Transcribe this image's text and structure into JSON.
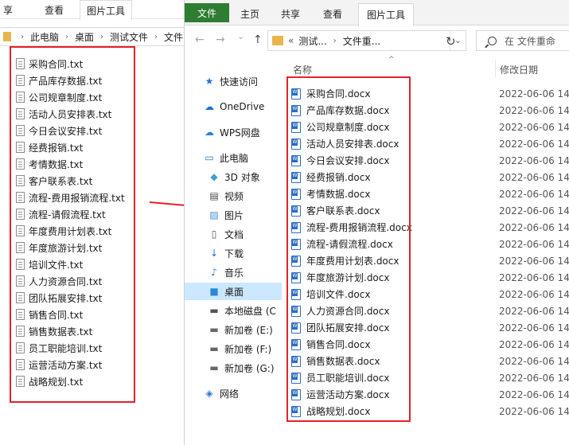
{
  "back_window": {
    "ribbon_tabs": [
      "享",
      "查看",
      "图片工具"
    ],
    "breadcrumb": [
      "此电脑",
      "桌面",
      "测试文件",
      "文件"
    ],
    "files": [
      "采购合同.txt",
      "产品库存数据.txt",
      "公司规章制度.txt",
      "活动人员安排表.txt",
      "今日会议安排.txt",
      "经费报销.txt",
      "考情数据.txt",
      "客户联系表.txt",
      "流程-费用报销流程.txt",
      "流程-请假流程.txt",
      "年度费用计划表.txt",
      "年度旅游计划.txt",
      "培训文件.txt",
      "人力资源合同.txt",
      "团队拓展安排.txt",
      "销售合同.txt",
      "销售数据表.txt",
      "员工职能培训.txt",
      "运营活动方案.txt",
      "战略规划.txt"
    ]
  },
  "front_window": {
    "ribbon_tabs": {
      "file": "文件",
      "home": "主页",
      "share": "共享",
      "view": "查看",
      "picture_tools": "图片工具"
    },
    "nav_buttons": {
      "back": "←",
      "forward": "→",
      "recent": "⌄",
      "up": "↑"
    },
    "address": {
      "prefix": "«",
      "path": [
        "测试...",
        "文件重..."
      ],
      "dropdown": "⌄"
    },
    "refresh": "↻",
    "search": {
      "placeholder": "在 文件重命"
    },
    "columns": {
      "name": "名称",
      "date": "修改日期"
    },
    "nav_pane": [
      {
        "label": "快速访问",
        "icon": "star-icon"
      },
      {
        "label": "OneDrive",
        "icon": "cloud-icon"
      },
      {
        "label": "WPS网盘",
        "icon": "wps-cloud-icon"
      },
      {
        "label": "此电脑",
        "icon": "computer-icon"
      },
      {
        "label": "3D 对象",
        "icon": "cube-icon"
      },
      {
        "label": "视频",
        "icon": "video-icon"
      },
      {
        "label": "图片",
        "icon": "picture-icon"
      },
      {
        "label": "文档",
        "icon": "document-icon"
      },
      {
        "label": "下载",
        "icon": "download-icon"
      },
      {
        "label": "音乐",
        "icon": "music-icon"
      },
      {
        "label": "桌面",
        "icon": "desktop-icon"
      },
      {
        "label": "本地磁盘 (C",
        "icon": "disk-icon"
      },
      {
        "label": "新加卷 (E:)",
        "icon": "drive-icon"
      },
      {
        "label": "新加卷 (F:)",
        "icon": "drive-icon"
      },
      {
        "label": "新加卷 (G:)",
        "icon": "drive-icon"
      },
      {
        "label": "网络",
        "icon": "network-icon"
      }
    ],
    "selected_nav": "桌面",
    "files": [
      {
        "name": "采购合同.docx",
        "date": "2022-06-06 14:"
      },
      {
        "name": "产品库存数据.docx",
        "date": "2022-06-06 14:"
      },
      {
        "name": "公司规章制度.docx",
        "date": "2022-06-06 14:"
      },
      {
        "name": "活动人员安排表.docx",
        "date": "2022-06-06 14:"
      },
      {
        "name": "今日会议安排.docx",
        "date": "2022-06-06 14:"
      },
      {
        "name": "经费报销.docx",
        "date": "2022-06-06 14:"
      },
      {
        "name": "考情数据.docx",
        "date": "2022-06-06 14:"
      },
      {
        "name": "客户联系表.docx",
        "date": "2022-06-06 14:"
      },
      {
        "name": "流程-费用报销流程.docx",
        "date": "2022-06-06 14:"
      },
      {
        "name": "流程-请假流程.docx",
        "date": "2022-06-06 14:"
      },
      {
        "name": "年度费用计划表.docx",
        "date": "2022-06-06 14:"
      },
      {
        "name": "年度旅游计划.docx",
        "date": "2022-06-06 14:"
      },
      {
        "name": "培训文件.docx",
        "date": "2022-06-06 14:"
      },
      {
        "name": "人力资源合同.docx",
        "date": "2022-06-06 14:"
      },
      {
        "name": "团队拓展安排.docx",
        "date": "2022-06-06 14:"
      },
      {
        "name": "销售合同.docx",
        "date": "2022-06-06 14:"
      },
      {
        "name": "销售数据表.docx",
        "date": "2022-06-06 14:"
      },
      {
        "name": "员工职能培训.docx",
        "date": "2022-06-06 14:"
      },
      {
        "name": "运营活动方案.docx",
        "date": "2022-06-06 14:"
      },
      {
        "name": "战略规划.docx",
        "date": "2022-06-06 14:"
      }
    ]
  },
  "colors": {
    "highlight": "#e2222a",
    "file_tab": "#2e7d32",
    "selected_nav": "#cce8ff",
    "folder": "#e8b64a",
    "word": "#2b6cc4"
  }
}
